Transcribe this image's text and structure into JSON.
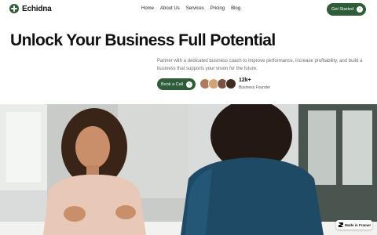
{
  "brand": {
    "name": "Echidna",
    "logo_icon": "echidna-logo-icon",
    "accent": "#2f5d3a"
  },
  "nav": {
    "items": [
      "Home",
      "About Us",
      "Services",
      "Pricing",
      "Blog"
    ],
    "cta_label": "Get Started",
    "cta_icon": "arrow-right-icon"
  },
  "hero": {
    "title": "Unlock Your Business Full Potential",
    "description": "Partner with a dedicated business coach to improve performance, increase profitability, and build a business that supports your vision for the future.",
    "button_label": "Book a Call",
    "button_icon": "arrow-right-icon",
    "stat_count": "12k+",
    "stat_label": "Business Founder",
    "avatars": [
      "founder-avatar",
      "founder-avatar",
      "founder-avatar",
      "founder-avatar"
    ]
  },
  "badge": {
    "label": "Made in Framer",
    "icon": "framer-icon"
  }
}
